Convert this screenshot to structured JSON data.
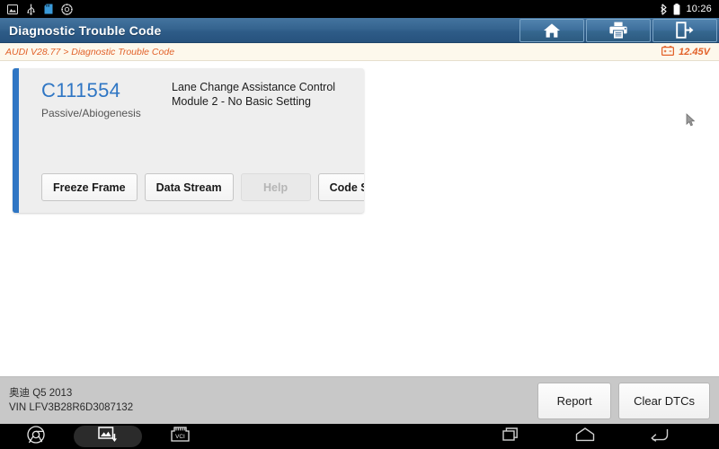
{
  "statusbar": {
    "icons": [
      "gallery-icon",
      "usb-icon",
      "sdcard-icon",
      "settings-icon"
    ],
    "right_icons": [
      "bluetooth-icon",
      "battery-icon"
    ],
    "clock": "10:26"
  },
  "header": {
    "title": "Diagnostic Trouble Code",
    "buttons": [
      {
        "name": "home-button",
        "label": "Home",
        "icon": "home-icon"
      },
      {
        "name": "print-button",
        "label": "Print",
        "icon": "printer-icon"
      },
      {
        "name": "exit-button",
        "label": "Exit",
        "icon": "exit-icon"
      }
    ]
  },
  "breadcrumb": {
    "path": "AUDI V28.77 > Diagnostic Trouble Code",
    "battery_icon": "battery-voltage-icon",
    "voltage": "12.45V",
    "accent_color": "#e2622a"
  },
  "dtc": {
    "code": "C111554",
    "status": "Passive/Abiogenesis",
    "description": "Lane Change Assistance Control Module 2 - No Basic Setting",
    "accent_color": "#2f76c4",
    "buttons": [
      {
        "name": "freeze-frame-button",
        "label": "Freeze Frame",
        "disabled": false
      },
      {
        "name": "data-stream-button",
        "label": "Data Stream",
        "disabled": false
      },
      {
        "name": "help-button",
        "label": "Help",
        "disabled": true
      },
      {
        "name": "code-search-button",
        "label": "Code Search",
        "disabled": false
      }
    ]
  },
  "vehicle": {
    "name": "奥迪 Q5 2013",
    "vin": "VIN LFV3B28R6D3087132"
  },
  "footer": {
    "report_label": "Report",
    "clear_dtcs_label": "Clear DTCs"
  },
  "navbar": {
    "app_icons": [
      {
        "name": "chrome-icon",
        "active": false
      },
      {
        "name": "screenshot-icon",
        "active": true
      },
      {
        "name": "vci-icon",
        "active": false,
        "label": "VCI"
      }
    ],
    "system_icons": [
      "recents-icon",
      "home-icon",
      "back-icon"
    ]
  }
}
